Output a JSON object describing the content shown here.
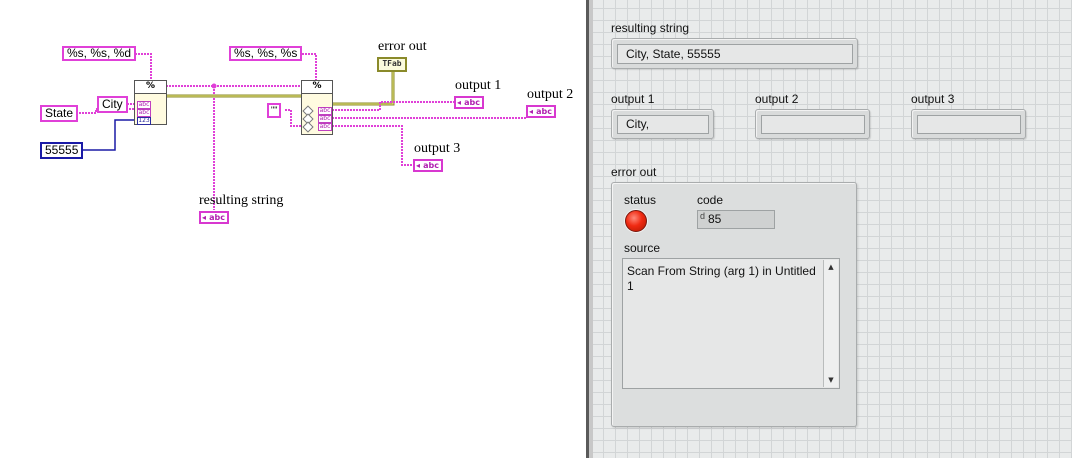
{
  "block_diagram": {
    "format_constant_1": "%s, %s, %d",
    "format_constant_2": "%s, %s, %s",
    "state_constant": "State",
    "city_constant": "City",
    "number_constant": "55555",
    "empty_string_constant": "\"\"",
    "format_func_symbol": "%",
    "scan_func_symbol": "%",
    "terminal_abc": "abc",
    "terminal_num": "123",
    "indicator_abc": "abc",
    "error_indicator_text": "TFab",
    "labels": {
      "error_out": "error out",
      "output_1": "output 1",
      "output_2": "output 2",
      "output_3": "output 3",
      "resulting_string": "resulting string"
    }
  },
  "front_panel": {
    "resulting_string": {
      "label": "resulting string",
      "value": "City, State, 55555"
    },
    "output_1": {
      "label": "output 1",
      "value": "City,"
    },
    "output_2": {
      "label": "output 2",
      "value": ""
    },
    "output_3": {
      "label": "output 3",
      "value": ""
    },
    "error_out": {
      "label": "error out",
      "status_label": "status",
      "status": true,
      "code_label": "code",
      "code_radix": "d",
      "code": "85",
      "source_label": "source",
      "source": "Scan From String (arg 1) in Untitled 1"
    }
  },
  "colors": {
    "string_wire": "#e040d8",
    "numeric_wire": "#1a1aa6",
    "error_wire": "#8a8a2a",
    "status_led": "#f02a12",
    "panel_bg": "#e9ebeb"
  },
  "icons": [
    "scroll-up-arrow-icon",
    "scroll-down-arrow-icon",
    "status-led-icon"
  ]
}
